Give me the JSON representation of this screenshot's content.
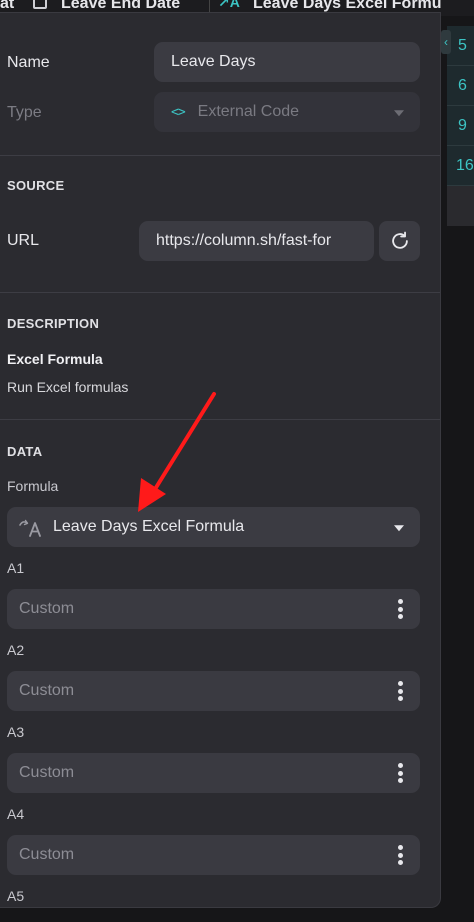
{
  "header": {
    "col1_label": "at",
    "col2_label": "Leave End Date",
    "col3_label": "Leave Days Excel Formu"
  },
  "grid_values": [
    "5",
    "6",
    "9",
    "16"
  ],
  "config": {
    "name_label": "Name",
    "name_value": "Leave Days",
    "type_label": "Type",
    "type_value": "External Code"
  },
  "source": {
    "title": "SOURCE",
    "url_label": "URL",
    "url_value": "https://column.sh/fast-for"
  },
  "description": {
    "title": "DESCRIPTION",
    "heading": "Excel Formula",
    "text": "Run Excel formulas"
  },
  "data": {
    "title": "DATA",
    "formula_label": "Formula",
    "formula_value": "Leave Days Excel Formula",
    "inputs": [
      {
        "label": "A1",
        "value": "Custom"
      },
      {
        "label": "A2",
        "value": "Custom"
      },
      {
        "label": "A3",
        "value": "Custom"
      },
      {
        "label": "A4",
        "value": "Custom"
      },
      {
        "label": "A5",
        "value": ""
      }
    ]
  },
  "colors": {
    "panel_bg": "#2b2b30",
    "field_bg": "#3b3b42",
    "accent_teal": "#3cc4c4",
    "annotation_red": "#ff1a1a"
  }
}
